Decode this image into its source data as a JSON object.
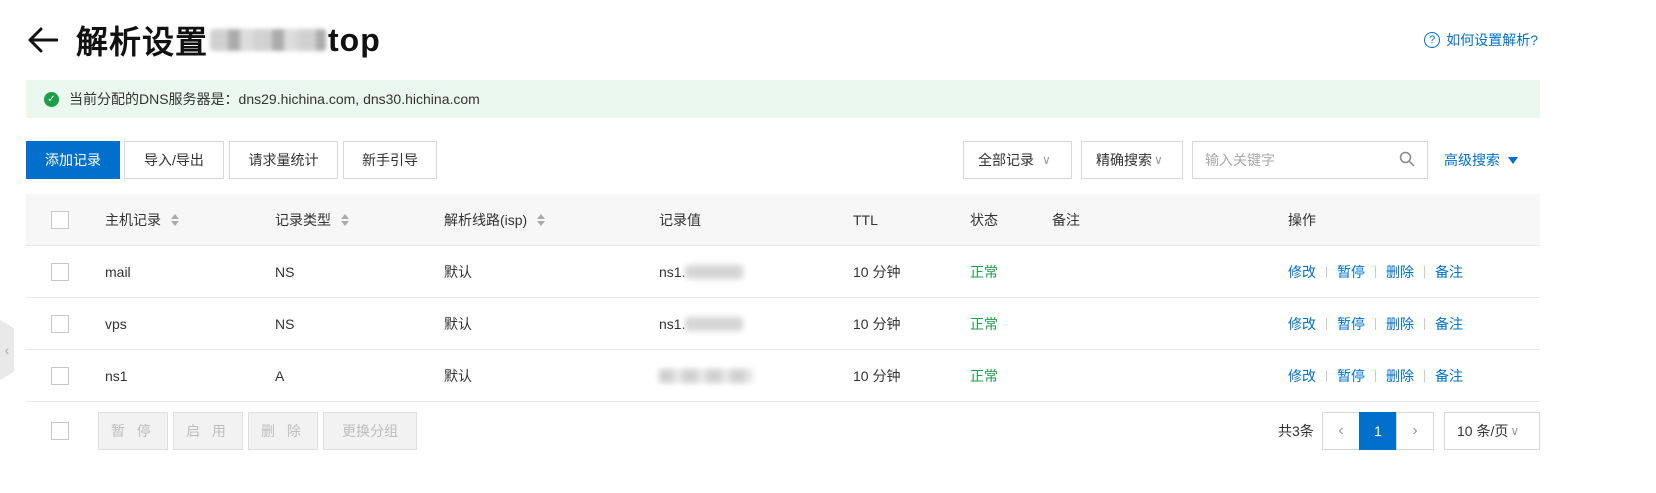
{
  "header": {
    "title_prefix": "解析设置",
    "title_suffix": "top",
    "help_label": "如何设置解析?"
  },
  "notice": {
    "text": "当前分配的DNS服务器是：dns29.hichina.com, dns30.hichina.com"
  },
  "toolbar": {
    "add_label": "添加记录",
    "import_export_label": "导入/导出",
    "stats_label": "请求量统计",
    "guide_label": "新手引导",
    "filter_select": "全部记录",
    "search_mode": "精确搜索",
    "search_placeholder": "输入关键字",
    "advanced_label": "高级搜索"
  },
  "table": {
    "headers": {
      "host": "主机记录",
      "type": "记录类型",
      "line": "解析线路(isp)",
      "value": "记录值",
      "ttl": "TTL",
      "status": "状态",
      "remark": "备注",
      "actions": "操作"
    },
    "rows": [
      {
        "host": "mail",
        "type": "NS",
        "line": "默认",
        "value": "ns1.",
        "ttl": "10 分钟",
        "status": "正常"
      },
      {
        "host": "vps",
        "type": "NS",
        "line": "默认",
        "value": "ns1.",
        "ttl": "10 分钟",
        "status": "正常"
      },
      {
        "host": "ns1",
        "type": "A",
        "line": "默认",
        "value": "",
        "ttl": "10 分钟",
        "status": "正常"
      }
    ],
    "action_labels": {
      "edit": "修改",
      "pause": "暂停",
      "delete": "删除",
      "remark": "备注"
    }
  },
  "footer": {
    "pause_label": "暂 停",
    "enable_label": "启 用",
    "delete_label": "删 除",
    "change_group_label": "更换分组",
    "total_label": "共3条",
    "current_page": "1",
    "page_size": "10 条/页"
  },
  "colors": {
    "primary": "#0070cc",
    "success": "#1e9e4b",
    "notice_bg": "#eaf8ef"
  }
}
